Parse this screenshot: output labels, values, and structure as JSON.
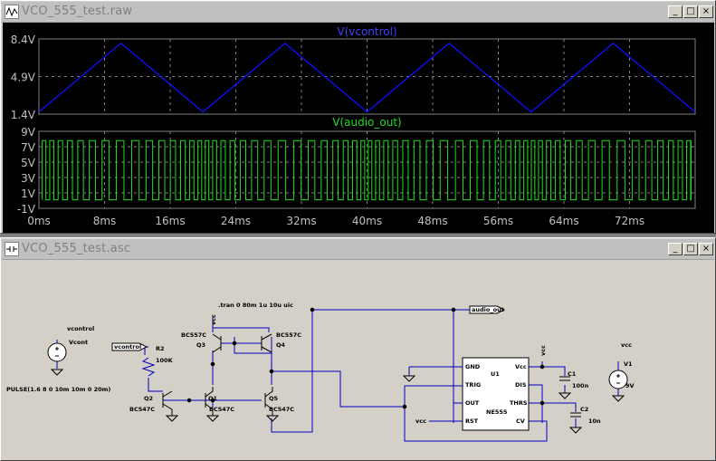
{
  "waveform_window": {
    "title": "VCO_555_test.raw",
    "buttons": {
      "minimize": "_",
      "maximize": "□",
      "close": "×"
    }
  },
  "schematic_window": {
    "title": "VCO_555_test.asc",
    "buttons": {
      "minimize": "_",
      "maximize": "□",
      "close": "×"
    }
  },
  "colors": {
    "plot_background": "#000000",
    "vcontrol_trace": "#1010ff",
    "audio_trace": "#22dd22",
    "wire": "#0000c0",
    "schematic_bg": "#d4d0c8"
  },
  "chart_data": [
    {
      "type": "line",
      "title": "V(vcontrol)",
      "yticks": [
        "8.4V",
        "4.9V",
        "1.4V"
      ],
      "ylim": [
        1.4,
        8.4
      ],
      "xlim": [
        0,
        80
      ],
      "series": [
        {
          "name": "V(vcontrol)",
          "x": [
            0,
            10,
            20,
            30,
            40,
            50,
            60,
            70,
            80
          ],
          "y": [
            1.6,
            8.0,
            1.6,
            8.0,
            1.6,
            8.0,
            1.6,
            8.0,
            1.6
          ]
        }
      ],
      "grid": true
    },
    {
      "type": "line",
      "title": "V(audio_out)",
      "yticks": [
        "9V",
        "7V",
        "5V",
        "3V",
        "1V",
        "-1V"
      ],
      "ylim": [
        -1,
        9
      ],
      "xlim": [
        0,
        80
      ],
      "xticks": [
        "0ms",
        "8ms",
        "16ms",
        "24ms",
        "32ms",
        "40ms",
        "48ms",
        "56ms",
        "64ms",
        "72ms"
      ],
      "series": [
        {
          "name": "V(audio_out)",
          "low": 0.1,
          "high": 7.8,
          "description": "square wave whose frequency tracks V(vcontrol)"
        }
      ],
      "grid": true
    }
  ],
  "schematic": {
    "labels": {
      "vcontrol_top": "vcontrol",
      "vcontrol_flag": "vcontrol",
      "vcont": "Vcont",
      "pulse": "PULSE(1.6 8 0 10m 10m 0 20m)",
      "r2": "R2",
      "r2_val": "100K",
      "q2": "Q2",
      "q2_type": "BC547C",
      "q1": "Q1",
      "q1_type": "BC547C",
      "q3": "Q3",
      "q3_type": "BC557C",
      "q4": "Q4",
      "q4_type": "BC557C",
      "q5": "Q5",
      "q5_type": "BC547C",
      "tran": ".tran 0 80m 1u 10u uic",
      "vcc_top": "vcc",
      "audio_out": "audio_out",
      "u1": "U1",
      "ne": "NE555",
      "gnd": "GND",
      "trig": "TRIG",
      "out": "OUT",
      "rst": "RST",
      "vcc_pin": "Vcc",
      "dis": "DIS",
      "thrs": "THRS",
      "cv": "CV",
      "vcc_left": "vcc",
      "vcc_c1": "vcc",
      "c1": "C1",
      "c1_val": "100n",
      "c2": "C2",
      "c2_val": "10n",
      "v1": "V1",
      "v1_val": "9V",
      "vcc_v1": "vcc"
    }
  }
}
